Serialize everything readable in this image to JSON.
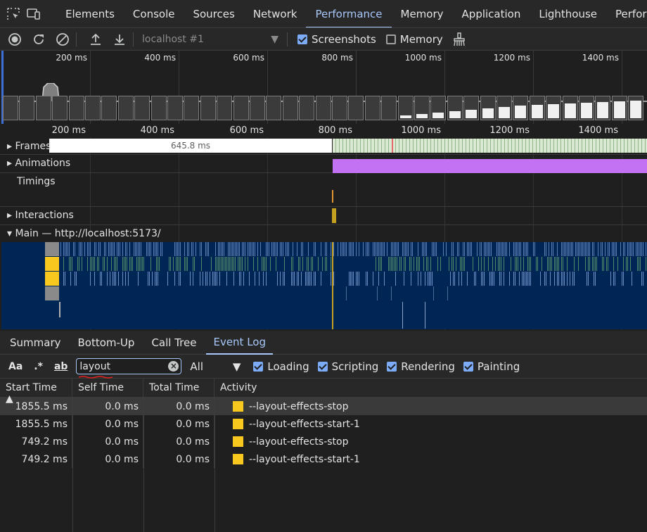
{
  "tabs": [
    "Elements",
    "Console",
    "Sources",
    "Network",
    "Performance",
    "Memory",
    "Application",
    "Lighthouse",
    "Performan"
  ],
  "toolbar": {
    "target": "localhost #1",
    "screenshots_label": "Screenshots",
    "screenshots_checked": true,
    "memory_label": "Memory",
    "memory_checked": false
  },
  "overview": {
    "ticks": [
      "200 ms",
      "400 ms",
      "600 ms",
      "800 ms",
      "1000 ms",
      "1200 ms",
      "1400 ms"
    ]
  },
  "ruler": {
    "ticks": [
      "200 ms",
      "400 ms",
      "600 ms",
      "800 ms",
      "1000 ms",
      "1200 ms",
      "1400 ms"
    ]
  },
  "tracks": {
    "frames": "Frames",
    "frames_duration": "645.8 ms",
    "animations": "Animations",
    "timings": "Timings",
    "interactions": "Interactions",
    "main": "Main — http://localhost:5173/"
  },
  "bottom_tabs": [
    "Summary",
    "Bottom-Up",
    "Call Tree",
    "Event Log"
  ],
  "filter": {
    "match_case": "Aa",
    "regex": ".*",
    "whole_word": "ab",
    "query": "layout",
    "category": "All",
    "checks": [
      {
        "label": "Loading",
        "checked": true
      },
      {
        "label": "Scripting",
        "checked": true
      },
      {
        "label": "Rendering",
        "checked": true
      },
      {
        "label": "Painting",
        "checked": true
      }
    ]
  },
  "table": {
    "columns": [
      "Start Time ▲",
      "Self Time",
      "Total Time",
      "Activity"
    ],
    "rows": [
      {
        "start": "1855.5 ms",
        "self": "0.0 ms",
        "total": "0.0 ms",
        "activity": "--layout-effects-stop"
      },
      {
        "start": "1855.5 ms",
        "self": "0.0 ms",
        "total": "0.0 ms",
        "activity": "--layout-effects-start-1"
      },
      {
        "start": "749.2 ms",
        "self": "0.0 ms",
        "total": "0.0 ms",
        "activity": "--layout-effects-stop"
      },
      {
        "start": "749.2 ms",
        "self": "0.0 ms",
        "total": "0.0 ms",
        "activity": "--layout-effects-start-1"
      }
    ]
  },
  "colors": {
    "accent": "#a8c7fa",
    "timing_marker": "#f8c81e",
    "animation": "#c272f2",
    "main_bg": "#002656"
  }
}
